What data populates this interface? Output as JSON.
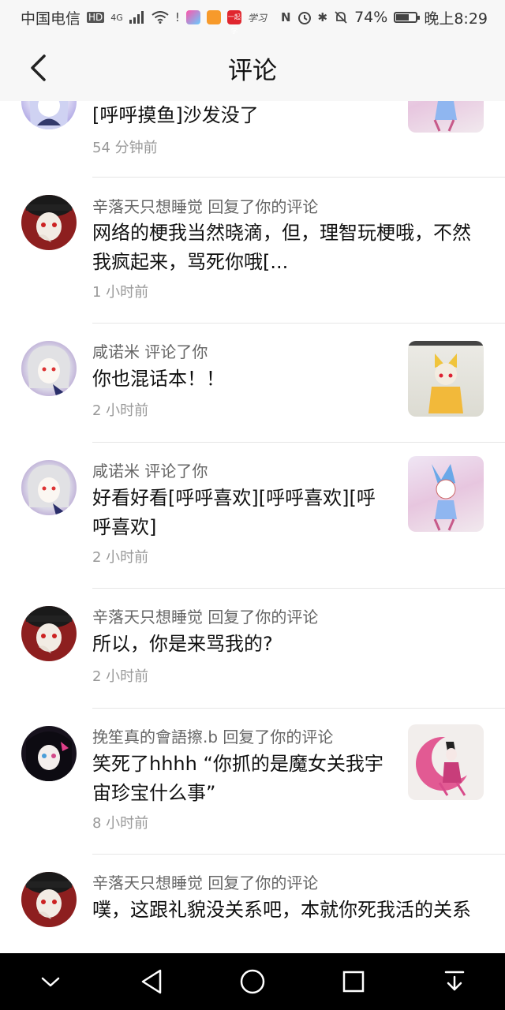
{
  "status_bar": {
    "carrier": "中国电信",
    "network_badge": "HD",
    "network_type": "4G",
    "app_label": "一起学",
    "app_label2": "学习",
    "battery": "74%",
    "battery_level": 0.74,
    "time": "晚上8:29",
    "icons": [
      "signal-icon",
      "wifi-icon",
      "alert-icon",
      "nfc-icon",
      "alarm-icon",
      "bluetooth-icon",
      "mute-icon",
      "battery-icon"
    ]
  },
  "header": {
    "title": "评论",
    "back_icon": "chevron-left-icon"
  },
  "comments": [
    {
      "name_line": "",
      "content": "[呼呼摸鱼]沙发没了",
      "time": "54 分钟前",
      "has_thumb": true
    },
    {
      "name_line": "辛落天只想睡觉 回复了你的评论",
      "content": "网络的梗我当然晓滴，但，理智玩梗哦，不然我疯起来，骂死你哦[...",
      "time": "1 小时前",
      "has_thumb": false
    },
    {
      "name_line": "咸诺米 评论了你",
      "content": "你也混话本！！",
      "time": "2 小时前",
      "has_thumb": true
    },
    {
      "name_line": "咸诺米 评论了你",
      "content": "好看好看[呼呼喜欢][呼呼喜欢][呼呼喜欢]",
      "time": "2 小时前",
      "has_thumb": true
    },
    {
      "name_line": "辛落天只想睡觉 回复了你的评论",
      "content": "所以，你是来骂我的?",
      "time": "2 小时前",
      "has_thumb": false
    },
    {
      "name_line": "挽笙真的會語擦.b 回复了你的评论",
      "content": "笑死了hhhh “你抓的是魔女关我宇宙珍宝什么事”",
      "time": "8 小时前",
      "has_thumb": true
    },
    {
      "name_line": "辛落天只想睡觉 回复了你的评论",
      "content": "噗，这跟礼貌没关系吧，本就你死我活的关系",
      "time": "",
      "has_thumb": false
    }
  ],
  "nav_bar": {
    "icons": [
      "chevron-down-icon",
      "back-triangle-icon",
      "home-circle-icon",
      "recents-square-icon",
      "download-icon"
    ]
  }
}
